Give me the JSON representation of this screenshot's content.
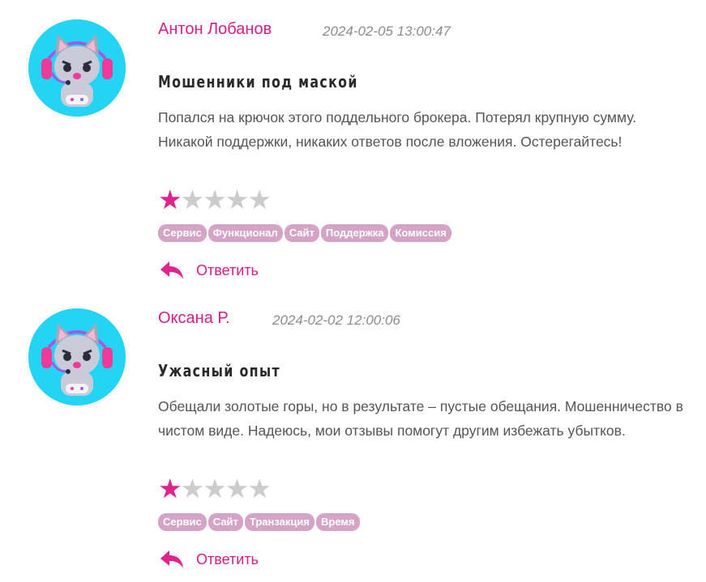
{
  "reviews": [
    {
      "author": "Антон Лобанов",
      "date": "2024-02-05 13:00:47",
      "title": "Мошенники под маской",
      "text": "Попался на крючок этого поддельного брокера. Потерял крупную сумму. Никакой поддержки, никаких ответов после вложения. Остерегайтесь!",
      "rating": 1,
      "max_rating": 5,
      "tags": [
        "Сервис",
        "Функционал",
        "Сайт",
        "Поддержка",
        "Комиссия"
      ],
      "reply_label": "Ответить",
      "avatar_icon": "gamer-cat-avatar-icon"
    },
    {
      "author": "Оксана Р.",
      "date": "2024-02-02 12:00:06",
      "title": "Ужасный опыт",
      "text": "Обещали золотые горы, но в результате – пустые обещания. Мошенничество в чистом виде. Надеюсь, мои отзывы помогут другим избежать убытков.",
      "rating": 1,
      "max_rating": 5,
      "tags": [
        "Сервис",
        "Сайт",
        "Транзакция",
        "Время"
      ],
      "reply_label": "Ответить",
      "avatar_icon": "gamer-cat-avatar-icon"
    }
  ],
  "colors": {
    "accent": "#d81b87",
    "star_on": "#e0228d",
    "star_off": "#cccccc",
    "tag_bg": "#d4a3c6",
    "avatar_bg": "#23d4f4"
  }
}
